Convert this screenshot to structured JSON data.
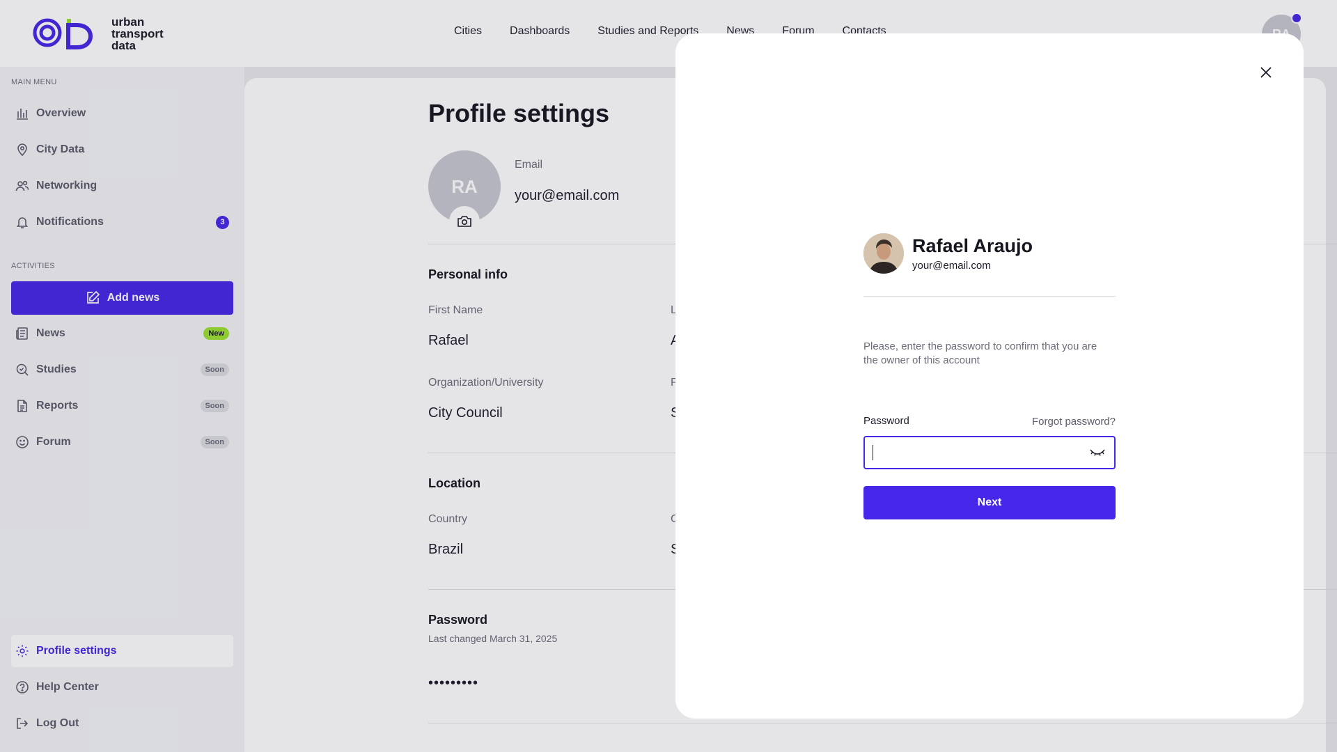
{
  "brand": {
    "line1": "urban",
    "line2": "transport",
    "line3": "data"
  },
  "nav": [
    "Cities",
    "Dashboards",
    "Studies and Reports",
    "News",
    "Forum",
    "Contacts"
  ],
  "user_initials": "RA",
  "sidebar": {
    "main_menu_label": "MAIN MENU",
    "activities_label": "ACTIVITIES",
    "main_items": [
      {
        "label": "Overview",
        "icon": "chart-bar-icon"
      },
      {
        "label": "City Data",
        "icon": "map-pin-icon"
      },
      {
        "label": "Networking",
        "icon": "users-icon"
      },
      {
        "label": "Notifications",
        "icon": "bell-icon",
        "badge": "3"
      }
    ],
    "add_news_label": "Add news",
    "activity_items": [
      {
        "label": "News",
        "icon": "newspaper-icon",
        "badge": "New"
      },
      {
        "label": "Studies",
        "icon": "search-icon",
        "badge": "Soon"
      },
      {
        "label": "Reports",
        "icon": "document-icon",
        "badge": "Soon"
      },
      {
        "label": "Forum",
        "icon": "smile-icon",
        "badge": "Soon"
      }
    ],
    "bottom_items": [
      {
        "label": "Profile settings",
        "icon": "gear-icon"
      },
      {
        "label": "Help Center",
        "icon": "question-icon"
      },
      {
        "label": "Log Out",
        "icon": "logout-icon"
      }
    ]
  },
  "profile": {
    "title": "Profile settings",
    "email_label": "Email",
    "email_value": "your@email.com",
    "personal_info_title": "Personal info",
    "first_name_label": "First Name",
    "first_name_value": "Rafael",
    "last_name_label_partial": "L",
    "last_name_value_partial": "A",
    "org_label": "Organization/University",
    "org_value": "City Council",
    "second_label_partial": "P",
    "second_value_partial": "S",
    "location_title": "Location",
    "country_label": "Country",
    "country_value": "Brazil",
    "city_label_partial": "C",
    "city_value_partial": "S",
    "password_title": "Password",
    "password_changed": "Last changed March 31, 2025",
    "password_mask": "•••••••••"
  },
  "modal": {
    "name": "Rafael Araujo",
    "email": "your@email.com",
    "description": "Please, enter the password to confirm that you are the owner of this account",
    "password_label": "Password",
    "forgot_label": "Forgot password?",
    "password_value": "",
    "next_label": "Next"
  },
  "colors": {
    "accent": "#4626e8",
    "new_badge": "#9be22f"
  }
}
